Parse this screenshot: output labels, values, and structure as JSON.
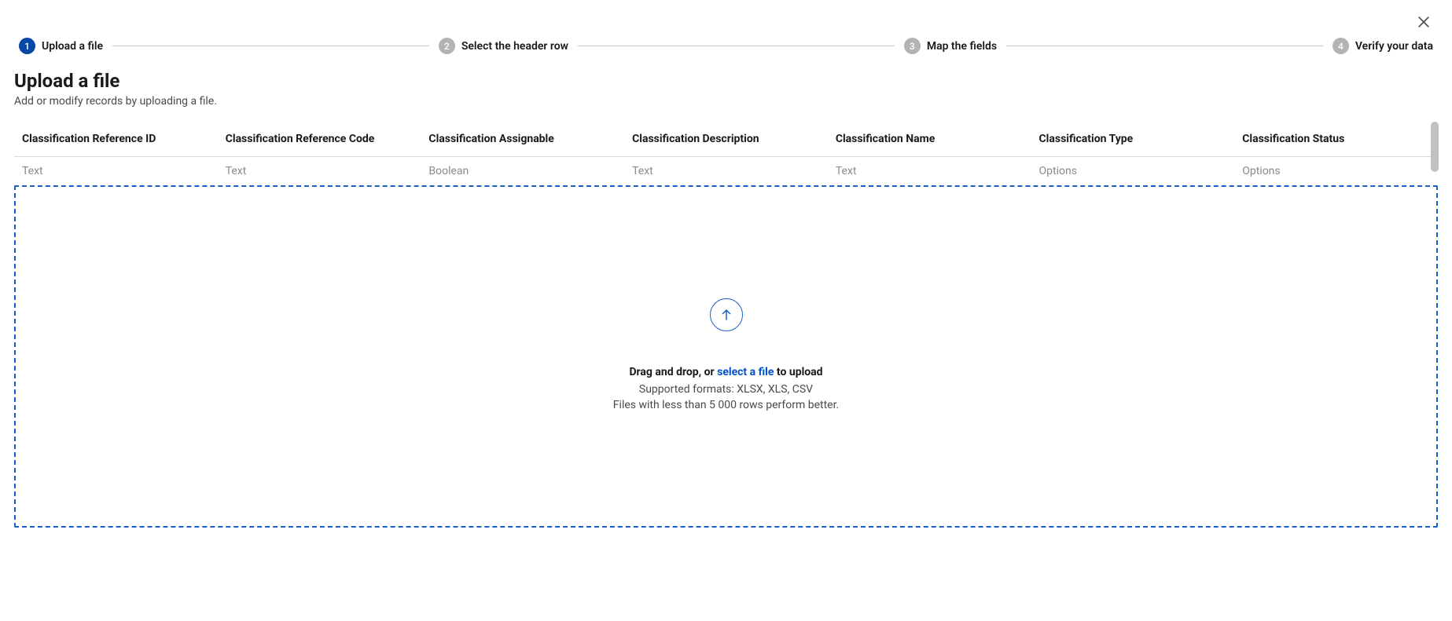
{
  "stepper": {
    "steps": [
      {
        "num": "1",
        "label": "Upload a file",
        "active": true
      },
      {
        "num": "2",
        "label": "Select the header row",
        "active": false
      },
      {
        "num": "3",
        "label": "Map the fields",
        "active": false
      },
      {
        "num": "4",
        "label": "Verify your data",
        "active": false
      }
    ]
  },
  "header": {
    "title": "Upload a file",
    "subtitle": "Add or modify records by uploading a file."
  },
  "table": {
    "columns": [
      {
        "name": "Classification Reference ID",
        "type": "Text"
      },
      {
        "name": "Classification Reference Code",
        "type": "Text"
      },
      {
        "name": "Classification Assignable",
        "type": "Boolean"
      },
      {
        "name": "Classification Description",
        "type": "Text"
      },
      {
        "name": "Classification Name",
        "type": "Text"
      },
      {
        "name": "Classification Type",
        "type": "Options"
      },
      {
        "name": "Classification Status",
        "type": "Options"
      }
    ]
  },
  "dropzone": {
    "prefix": "Drag and drop, or ",
    "link": "select a file",
    "suffix": " to upload",
    "formats": "Supported formats: XLSX, XLS, CSV",
    "hint": "Files with less than 5 000 rows perform better."
  }
}
